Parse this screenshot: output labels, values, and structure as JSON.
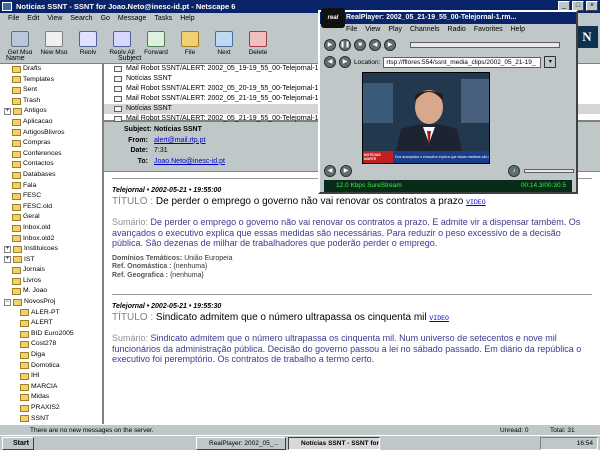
{
  "window": {
    "title": "Notícias SSNT - SSNT for Joao.Neto@inesc-id.pt - Netscape 6",
    "buttons": [
      "_",
      "□",
      "×"
    ]
  },
  "menu": [
    "File",
    "Edit",
    "View",
    "Search",
    "Go",
    "Message",
    "Tasks",
    "Help"
  ],
  "toolbar": [
    {
      "label": "Get Msg",
      "icon": "get-mail-icon"
    },
    {
      "label": "New Msg",
      "icon": "new-mail-icon"
    },
    {
      "label": "Reply",
      "icon": "reply-icon"
    },
    {
      "label": "Reply All",
      "icon": "reply-all-icon"
    },
    {
      "label": "Forward",
      "icon": "forward-icon"
    },
    {
      "label": "File",
      "icon": "file-icon"
    },
    {
      "label": "Next",
      "icon": "next-icon"
    },
    {
      "label": "Delete",
      "icon": "delete-icon"
    }
  ],
  "folders": {
    "header": "Name",
    "items": [
      {
        "label": "Drafts",
        "indent": 1,
        "exp": ""
      },
      {
        "label": "Templates",
        "indent": 1,
        "exp": ""
      },
      {
        "label": "Sent",
        "indent": 1,
        "exp": ""
      },
      {
        "label": "Trash",
        "indent": 1,
        "exp": ""
      },
      {
        "label": "Antigos",
        "indent": 0,
        "exp": "+"
      },
      {
        "label": "Aplicacao",
        "indent": 1,
        "exp": ""
      },
      {
        "label": "ArtigosBlivros",
        "indent": 1,
        "exp": ""
      },
      {
        "label": "Compras",
        "indent": 1,
        "exp": ""
      },
      {
        "label": "Conferences",
        "indent": 1,
        "exp": ""
      },
      {
        "label": "Contactos",
        "indent": 1,
        "exp": ""
      },
      {
        "label": "Databases",
        "indent": 1,
        "exp": ""
      },
      {
        "label": "Fala",
        "indent": 1,
        "exp": ""
      },
      {
        "label": "FESC",
        "indent": 1,
        "exp": ""
      },
      {
        "label": "FESC.old",
        "indent": 1,
        "exp": ""
      },
      {
        "label": "Geral",
        "indent": 1,
        "exp": ""
      },
      {
        "label": "Inbox.old",
        "indent": 1,
        "exp": ""
      },
      {
        "label": "Inbox.old2",
        "indent": 1,
        "exp": ""
      },
      {
        "label": "Instituicoes",
        "indent": 0,
        "exp": "+"
      },
      {
        "label": "IST",
        "indent": 0,
        "exp": "+"
      },
      {
        "label": "Jornais",
        "indent": 1,
        "exp": ""
      },
      {
        "label": "Livros",
        "indent": 1,
        "exp": ""
      },
      {
        "label": "M. Joao",
        "indent": 1,
        "exp": ""
      },
      {
        "label": "NovosProj",
        "indent": 0,
        "exp": "−"
      },
      {
        "label": "ALER-PT",
        "indent": 2,
        "exp": ""
      },
      {
        "label": "ALERT",
        "indent": 2,
        "exp": ""
      },
      {
        "label": "BID Euro2005",
        "indent": 2,
        "exp": ""
      },
      {
        "label": "Cost278",
        "indent": 2,
        "exp": ""
      },
      {
        "label": "Diga",
        "indent": 2,
        "exp": ""
      },
      {
        "label": "Domotica",
        "indent": 2,
        "exp": ""
      },
      {
        "label": "IHI",
        "indent": 2,
        "exp": ""
      },
      {
        "label": "MARCIA",
        "indent": 2,
        "exp": ""
      },
      {
        "label": "Midas",
        "indent": 2,
        "exp": ""
      },
      {
        "label": "PRAXIS2",
        "indent": 2,
        "exp": ""
      },
      {
        "label": "SSNT",
        "indent": 2,
        "exp": ""
      }
    ]
  },
  "messages": {
    "header": "Subject",
    "rows": [
      {
        "subject": "Mail Robot SSNT/ALERT: 2002_05_19-19_55_00-Telejornal-1.xm",
        "selected": false
      },
      {
        "subject": "Notícias SSNT",
        "selected": false
      },
      {
        "subject": "Mail Robot SSNT/ALERT: 2002_05_20-19_55_00-Telejornal-1.xm",
        "selected": false
      },
      {
        "subject": "Mail Robot SSNT/ALERT: 2002_05_21-19_55_00-Telejornal-1.xm",
        "selected": false
      },
      {
        "subject": "Notícias SSNT",
        "selected": true
      },
      {
        "subject": "Mail Robot SSNT/ALERT: 2002_05_21-19_55_00-Telejornal-1.xm",
        "selected": false
      }
    ]
  },
  "header": {
    "subject_label": "Subject:",
    "subject": "Notícias SSNT",
    "from_label": "From:",
    "from": "alert@mail.rtp.pt",
    "date_label": "Date:",
    "date": "7:31",
    "to_label": "To:",
    "to": "Joao.Neto@inesc-id.pt"
  },
  "articles": [
    {
      "meta": "Telejornal • 2002-05-21 • 19:55:00",
      "title_label": "TÍTULO :",
      "title": "De perder o emprego o governo não vai renovar os contratos a prazo",
      "video": "VIDEO",
      "summary_label": "Sumário:",
      "summary": "De perder o emprego o governo não vai renovar os contratos a prazo. E admite vir a dispensar também. Os avançados o executivo explica que essas medidas são necessárias. Para reduzir o peso excessivo de a decisão pública. São dezenas de milhar de trabalhadores que poderão perder o emprego.",
      "dom_label": "Domínios Temáticos:",
      "dom": "União Europeia",
      "onom_label": "Ref. Onomástica :",
      "onom": "{nenhuma}",
      "geo_label": "Ref. Geografica :",
      "geo": "{nenhuma}"
    },
    {
      "meta": "Telejornal • 2002-05-21 • 19:55:30",
      "title_label": "TÍTULO :",
      "title": "Sindicato admitem que o número ultrapassa os cinquenta mil",
      "video": "VIDEO",
      "summary_label": "Sumário:",
      "summary": "Sindicato admitem que o número ultrapassa os cinquenta mil. Num universo de setecentos e nove mil funcionários da administração pública. Decisão do governo passou a lei no sábado passado. Em diário da república o executivo foi peremptório. Os contratos de trabalho a termo certo."
    }
  ],
  "status": {
    "text": "There are no new messages on the server.",
    "unread": "Unread: 0",
    "total": "Total: 31"
  },
  "taskbar": {
    "start": "Start",
    "tasks": [
      "RealPlayer: 2002_05_...",
      "Notícias SSNT - SSNT for ..."
    ],
    "clock": "16:54"
  },
  "realplayer": {
    "logo": "real",
    "title": "RealPlayer: 2002_05_21-19_55_00-Telejornal-1.rm...",
    "menu": [
      "File",
      "View",
      "Play",
      "Channels",
      "Radio",
      "Favorites",
      "Help"
    ],
    "location_label": "Location:",
    "location": "rtsp://fflores:554/ssnt_media_clips/2002_05_21-19_",
    "stream": "12.0 Kbps SureStream",
    "time": "00:14.3/00:30.5",
    "video_caption": "Dos avançados o executivo explica que essas medidas são necessárias",
    "video_logo": "NOTÍCIAS NORTE"
  },
  "netscape_logo": "N"
}
